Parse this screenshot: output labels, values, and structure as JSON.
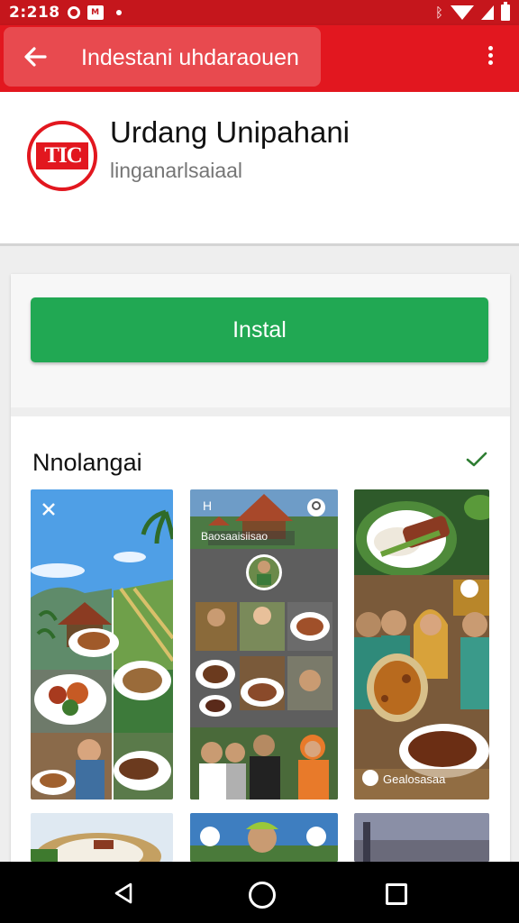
{
  "status_bar": {
    "time": "2:218",
    "notification_badge": "M"
  },
  "app_bar": {
    "title": "Indestani uhdaraouen"
  },
  "app": {
    "name": "Urdang Unipahani",
    "developer": "linganarlsaiaal",
    "logo_text": "TIC"
  },
  "install_button": {
    "label": "Instal"
  },
  "screenshots": {
    "title": "Nnolangai",
    "items": [
      {
        "name": "screenshot-1",
        "icon": "close-icon",
        "caption": ""
      },
      {
        "name": "screenshot-2",
        "icon": "map-pin-icon",
        "caption": "Baosaaisiisao"
      },
      {
        "name": "screenshot-3",
        "icon": "chat-icon",
        "caption": "Gealosasaa"
      },
      {
        "name": "screenshot-4",
        "icon": "",
        "caption": ""
      },
      {
        "name": "screenshot-5",
        "icon": "share-icon",
        "caption": ""
      },
      {
        "name": "screenshot-6",
        "icon": "",
        "caption": ""
      }
    ]
  },
  "colors": {
    "status_bar": "#c5161c",
    "app_bar": "#e2171f",
    "install_green": "#21a853",
    "check_green": "#2e7d32"
  }
}
